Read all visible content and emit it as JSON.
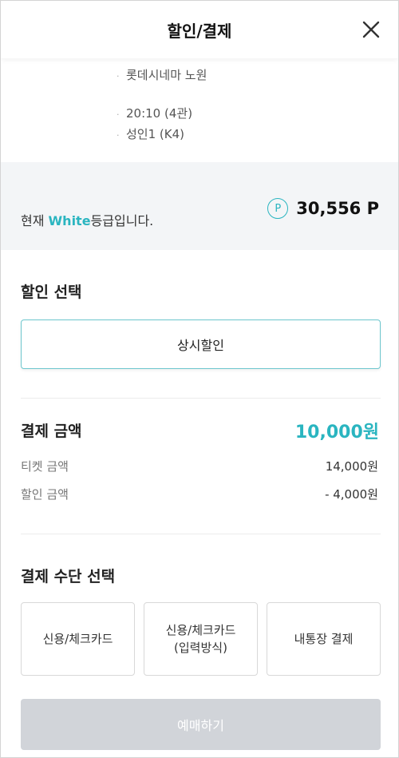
{
  "header": {
    "title": "할인/결제",
    "close_icon": "close-icon"
  },
  "movie_info": {
    "dot": "·",
    "cinema": "롯데시네마 노원",
    "time": "20:10 (4관)",
    "seat": "성인1 (K4)"
  },
  "grade": {
    "prefix": "현재 ",
    "name": "White",
    "suffix": "등급입니다.",
    "point_icon_label": "P",
    "points": "30,556 P",
    "accent_color": "#2ab5c0"
  },
  "discount": {
    "title": "할인 선택",
    "option_label": "상시할인"
  },
  "payment": {
    "title": "결제 금액",
    "total": "10,000원",
    "ticket_label": "티켓 금액",
    "ticket_value": "14,000원",
    "discount_label": "할인 금액",
    "discount_value": "- 4,000원"
  },
  "methods": {
    "title": "결제 수단 선택",
    "items": [
      {
        "label": "신용/체크카드"
      },
      {
        "label": "신용/체크카드\n(입력방식)"
      },
      {
        "label": "내통장 결제"
      }
    ]
  },
  "submit": {
    "label": "예매하기",
    "state": "disabled"
  }
}
